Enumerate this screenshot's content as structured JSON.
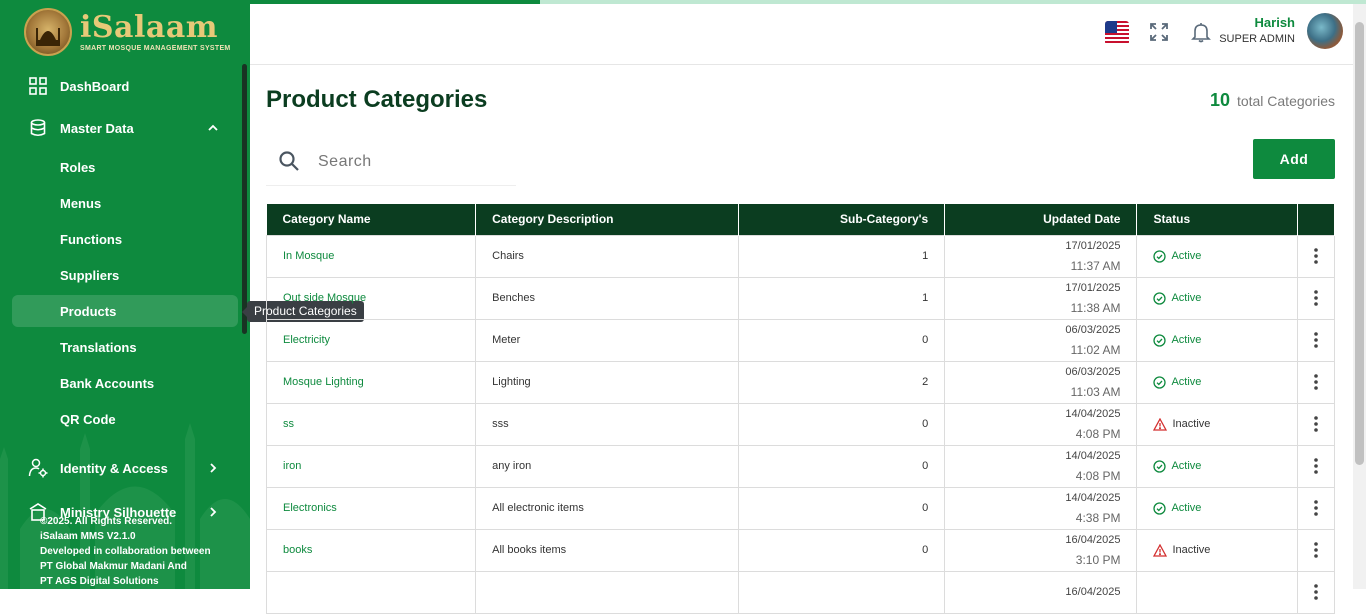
{
  "brand": {
    "name": "iSalaam",
    "tagline": "SMART MOSQUE MANAGEMENT SYSTEM"
  },
  "sidebar": {
    "items": [
      {
        "label": "DashBoard",
        "icon": "grid-icon"
      },
      {
        "label": "Master Data",
        "icon": "database-icon",
        "expanded": true
      },
      {
        "label": "Identity & Access",
        "icon": "user-gear-icon"
      },
      {
        "label": "Ministry Silhouette",
        "icon": "building-icon"
      }
    ],
    "sub_items": [
      "Roles",
      "Menus",
      "Functions",
      "Suppliers",
      "Products",
      "Translations",
      "Bank Accounts",
      "QR Code"
    ],
    "active_sub": "Products",
    "tooltip": "Product Categories"
  },
  "footer": {
    "line1": "©2025. All Rights Reserved.",
    "line2": "iSalaam MMS V2.1.0",
    "line3": "Developed in collaboration between",
    "line4": "PT Global Makmur Madani And",
    "line5": "PT AGS Digital Solutions"
  },
  "header": {
    "user_name": "Harish",
    "user_role": "SUPER ADMIN",
    "language_flag": "us-flag-icon"
  },
  "page": {
    "title": "Product Categories",
    "total_count": "10",
    "total_label": "total Categories",
    "search_placeholder": "Search",
    "add_label": "Add"
  },
  "table": {
    "columns": [
      "Category Name",
      "Category Description",
      "Sub-Category's",
      "Updated Date",
      "Status"
    ],
    "rows": [
      {
        "name": "In Mosque",
        "description": "Chairs",
        "subcount": "1",
        "date": "17/01/2025",
        "time": "11:37 AM",
        "status": "Active"
      },
      {
        "name": "Out side Mosque",
        "description": "Benches",
        "subcount": "1",
        "date": "17/01/2025",
        "time": "11:38 AM",
        "status": "Active"
      },
      {
        "name": "Electricity",
        "description": "Meter",
        "subcount": "0",
        "date": "06/03/2025",
        "time": "11:02 AM",
        "status": "Active"
      },
      {
        "name": "Mosque Lighting",
        "description": "Lighting",
        "subcount": "2",
        "date": "06/03/2025",
        "time": "11:03 AM",
        "status": "Active"
      },
      {
        "name": "ss",
        "description": "sss",
        "subcount": "0",
        "date": "14/04/2025",
        "time": "4:08 PM",
        "status": "Inactive"
      },
      {
        "name": "iron",
        "description": "any iron",
        "subcount": "0",
        "date": "14/04/2025",
        "time": "4:08 PM",
        "status": "Active"
      },
      {
        "name": "Electronics",
        "description": "All electronic items",
        "subcount": "0",
        "date": "14/04/2025",
        "time": "4:38 PM",
        "status": "Active"
      },
      {
        "name": "books",
        "description": "All books items",
        "subcount": "0",
        "date": "16/04/2025",
        "time": "3:10 PM",
        "status": "Inactive"
      },
      {
        "name": "",
        "description": "",
        "subcount": "",
        "date": "16/04/2025",
        "time": "",
        "status": ""
      }
    ]
  },
  "colors": {
    "primary": "#0e8a3e",
    "header_dark": "#0b3d20",
    "inactive": "#d32f2f"
  },
  "progress": {
    "value": 0.26
  }
}
